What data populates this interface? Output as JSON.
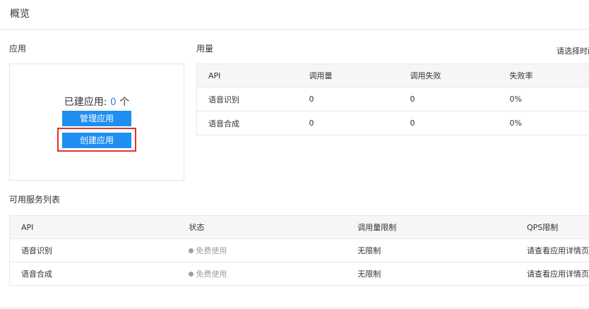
{
  "page": {
    "title": "概览"
  },
  "apps": {
    "section_title": "应用",
    "count_label": "已建应用: ",
    "count": "0",
    "count_unit": " 个",
    "manage_button": "管理应用",
    "create_button": "创建应用"
  },
  "usage": {
    "section_title": "用量",
    "range_prompt": "请选择时间",
    "columns": [
      "API",
      "调用量",
      "调用失败",
      "失败率"
    ],
    "rows": [
      [
        "语音识别",
        "0",
        "0",
        "0%"
      ],
      [
        "语音合成",
        "0",
        "0",
        "0%"
      ]
    ]
  },
  "services": {
    "section_title": "可用服务列表",
    "columns": [
      "API",
      "状态",
      "调用量限制",
      "QPS限制"
    ],
    "rows": [
      {
        "api": "语音识别",
        "status": "免费使用",
        "quota": "无限制",
        "qps": "请查看应用详情页"
      },
      {
        "api": "语音合成",
        "status": "免费使用",
        "quota": "无限制",
        "qps": "请查看应用详情页"
      }
    ]
  },
  "colors": {
    "primary": "#1e8ff0",
    "highlight": "#e3322f",
    "count_number": "#2f89f0",
    "status_gray": "#a0a0a0"
  },
  "icons": {
    "status": "status-dot-icon"
  }
}
